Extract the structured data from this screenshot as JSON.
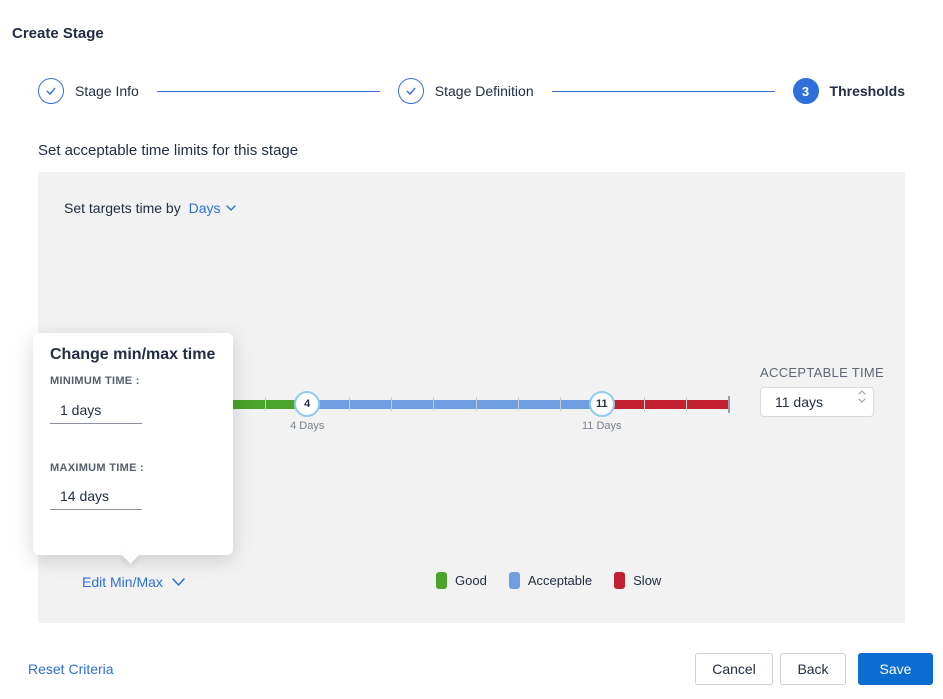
{
  "page": {
    "title": "Create Stage",
    "subtitle": "Set acceptable time limits for this stage"
  },
  "stepper": {
    "steps": [
      {
        "label": "Stage Info",
        "state": "complete"
      },
      {
        "label": "Stage Definition",
        "state": "complete"
      },
      {
        "label": "Thresholds",
        "state": "active",
        "number": "3"
      }
    ]
  },
  "panel": {
    "target_time_label": "Set targets time by",
    "target_time_value": "Days",
    "slider": {
      "min_day": 1,
      "max_day": 14,
      "handles": [
        {
          "value": "4",
          "label": "4 Days"
        },
        {
          "value": "11",
          "label": "11 Days"
        }
      ],
      "segments": [
        {
          "name": "Good",
          "color": "#4aa32a"
        },
        {
          "name": "Acceptable",
          "color": "#6f9fe2"
        },
        {
          "name": "Slow",
          "color": "#c22131"
        }
      ]
    },
    "acceptable_time": {
      "label": "ACCEPTABLE TIME",
      "value": "11 days"
    },
    "edit_minmax_label": "Edit Min/Max"
  },
  "popover": {
    "title": "Change min/max time",
    "min_label": "MINIMUM TIME :",
    "min_value": "1 days",
    "max_label": "MAXIMUM TIME :",
    "max_value": "14 days"
  },
  "footer": {
    "reset_label": "Reset Criteria",
    "cancel_label": "Cancel",
    "back_label": "Back",
    "save_label": "Save"
  },
  "colors": {
    "accent_blue": "#2e6fd8",
    "save_blue": "#0b6dd0",
    "handle_ring": "#8ecdee",
    "panel_bg": "#f2f2f2"
  }
}
